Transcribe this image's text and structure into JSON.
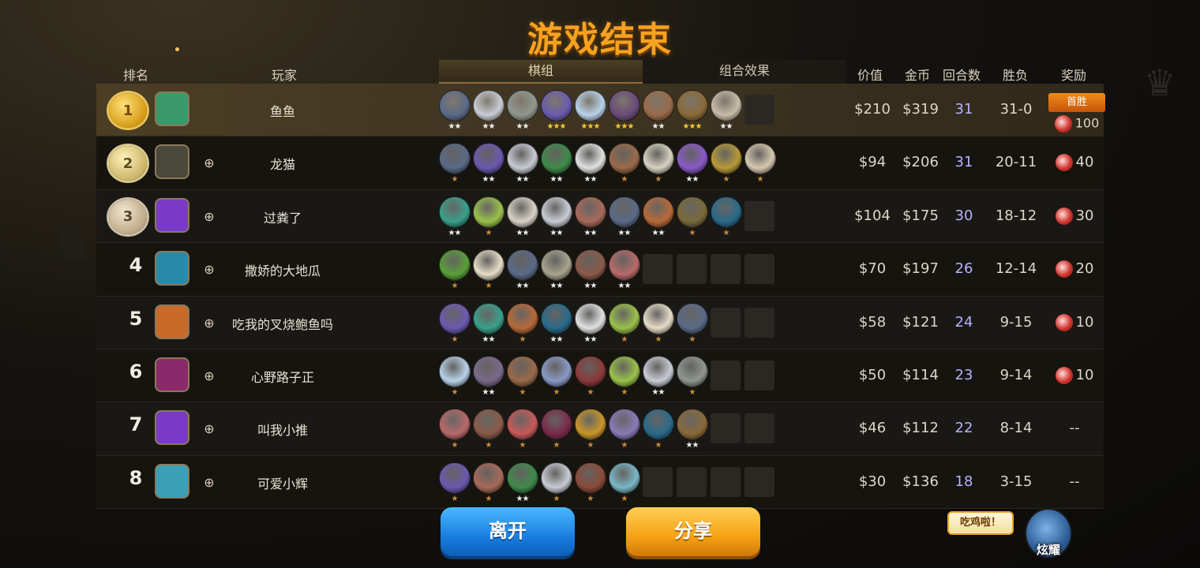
{
  "title": "游戏结束",
  "headers": {
    "rank": "排名",
    "player": "玩家",
    "team": "棋组",
    "combo": "组合效果",
    "value": "价值",
    "gold": "金币",
    "rounds": "回合数",
    "wl": "胜负",
    "reward": "奖励"
  },
  "rows": [
    {
      "rank": "1",
      "medal": "gold",
      "name": "鱼鱼",
      "value": "$210",
      "gold": "$319",
      "rounds": "31",
      "wl": "31-0",
      "reward": "100",
      "first_win": "首胜",
      "units": [
        {
          "c": "#5a6a88",
          "s": "★★"
        },
        {
          "c": "#c9ccd6",
          "s": "★★"
        },
        {
          "c": "#8f9890",
          "s": "★★"
        },
        {
          "c": "#6a5ab0",
          "s": "★★★",
          "t": "gold"
        },
        {
          "c": "#b8d2ea",
          "s": "★★★",
          "t": "gold"
        },
        {
          "c": "#6a4a7a",
          "s": "★★★",
          "t": "gold"
        },
        {
          "c": "#9a6a4a",
          "s": "★★"
        },
        {
          "c": "#8a6a3a",
          "s": "★★★",
          "t": "gold"
        },
        {
          "c": "#c8bca8",
          "s": "★★"
        },
        {
          "c": "",
          "s": ""
        }
      ]
    },
    {
      "rank": "2",
      "medal": "silver",
      "name": "龙猫",
      "value": "$94",
      "gold": "$206",
      "rounds": "31",
      "wl": "20-11",
      "reward": "40",
      "units": [
        {
          "c": "#5a6a88",
          "s": "★",
          "t": "bronze"
        },
        {
          "c": "#6a5ab0",
          "s": "★★"
        },
        {
          "c": "#c9ccd6",
          "s": "★★"
        },
        {
          "c": "#3f8a4a",
          "s": "★★"
        },
        {
          "c": "#e2e2e2",
          "s": "★★"
        },
        {
          "c": "#9a6a4a",
          "s": "★",
          "t": "bronze"
        },
        {
          "c": "#d8d2c0",
          "s": "★",
          "t": "bronze"
        },
        {
          "c": "#8a5ac8",
          "s": "★★"
        },
        {
          "c": "#b89a3a",
          "s": "★",
          "t": "bronze"
        },
        {
          "c": "#d8c8b0",
          "s": "★",
          "t": "bronze"
        }
      ]
    },
    {
      "rank": "3",
      "medal": "bronze",
      "name": "过粪了",
      "value": "$104",
      "gold": "$175",
      "rounds": "30",
      "wl": "18-12",
      "reward": "30",
      "units": [
        {
          "c": "#3aa08a",
          "s": "★★"
        },
        {
          "c": "#9ac24a",
          "s": "★",
          "t": "bronze"
        },
        {
          "c": "#d8d2c6",
          "s": "★★"
        },
        {
          "c": "#c9ccd6",
          "s": "★★"
        },
        {
          "c": "#a86a5a",
          "s": "★★"
        },
        {
          "c": "#5a6a88",
          "s": "★★"
        },
        {
          "c": "#b86a3a",
          "s": "★★"
        },
        {
          "c": "#7a6a3a",
          "s": "★",
          "t": "bronze"
        },
        {
          "c": "#2a6a8a",
          "s": "★",
          "t": "bronze"
        },
        {
          "c": "",
          "s": ""
        }
      ]
    },
    {
      "rank": "4",
      "medal": "",
      "name": "撒娇的大地瓜",
      "value": "$70",
      "gold": "$197",
      "rounds": "26",
      "wl": "12-14",
      "reward": "20",
      "units": [
        {
          "c": "#5aa03a",
          "s": "★",
          "t": "bronze"
        },
        {
          "c": "#e6ddc8",
          "s": "★",
          "t": "bronze"
        },
        {
          "c": "#5a6a88",
          "s": "★★"
        },
        {
          "c": "#a8a490",
          "s": "★★"
        },
        {
          "c": "#8a5a4a",
          "s": "★★"
        },
        {
          "c": "#b86a6a",
          "s": "★★"
        },
        {
          "c": "",
          "s": ""
        },
        {
          "c": "",
          "s": ""
        },
        {
          "c": "",
          "s": ""
        },
        {
          "c": "",
          "s": ""
        }
      ]
    },
    {
      "rank": "5",
      "medal": "",
      "name": "吃我的叉烧鲍鱼吗",
      "value": "$58",
      "gold": "$121",
      "rounds": "24",
      "wl": "9-15",
      "reward": "10",
      "units": [
        {
          "c": "#6a5ab0",
          "s": "★",
          "t": "bronze"
        },
        {
          "c": "#3aa08a",
          "s": "★★"
        },
        {
          "c": "#b86a3a",
          "s": "★",
          "t": "bronze"
        },
        {
          "c": "#2a6a8a",
          "s": "★★"
        },
        {
          "c": "#e2e2e2",
          "s": "★★"
        },
        {
          "c": "#9ac24a",
          "s": "★",
          "t": "bronze"
        },
        {
          "c": "#e6ddc8",
          "s": "★",
          "t": "bronze"
        },
        {
          "c": "#5a6a88",
          "s": "★",
          "t": "bronze"
        },
        {
          "c": "",
          "s": ""
        },
        {
          "c": "",
          "s": ""
        }
      ]
    },
    {
      "rank": "6",
      "medal": "",
      "name": "心野路子正",
      "value": "$50",
      "gold": "$114",
      "rounds": "23",
      "wl": "9-14",
      "reward": "10",
      "units": [
        {
          "c": "#b8d2ea",
          "s": "★",
          "t": "bronze"
        },
        {
          "c": "#7a6a8a",
          "s": "★★"
        },
        {
          "c": "#9a6a4a",
          "s": "★",
          "t": "bronze"
        },
        {
          "c": "#8a9ac8",
          "s": "★",
          "t": "bronze"
        },
        {
          "c": "#8a3a3a",
          "s": "★",
          "t": "bronze"
        },
        {
          "c": "#9ac24a",
          "s": "★",
          "t": "bronze"
        },
        {
          "c": "#c9ccd6",
          "s": "★★"
        },
        {
          "c": "#8f9890",
          "s": "★",
          "t": "bronze"
        },
        {
          "c": "",
          "s": ""
        },
        {
          "c": "",
          "s": ""
        }
      ]
    },
    {
      "rank": "7",
      "medal": "",
      "name": "叫我小推",
      "value": "$46",
      "gold": "$112",
      "rounds": "22",
      "wl": "8-14",
      "reward": "--",
      "units": [
        {
          "c": "#b86a6a",
          "s": "★",
          "t": "bronze"
        },
        {
          "c": "#8a5a4a",
          "s": "★",
          "t": "bronze"
        },
        {
          "c": "#c85a5a",
          "s": "★",
          "t": "bronze"
        },
        {
          "c": "#7a2a4a",
          "s": "★",
          "t": "bronze"
        },
        {
          "c": "#c8962a",
          "s": "★",
          "t": "bronze"
        },
        {
          "c": "#8a7ab8",
          "s": "★",
          "t": "bronze"
        },
        {
          "c": "#2a6a8a",
          "s": "★",
          "t": "bronze"
        },
        {
          "c": "#8a6a3a",
          "s": "★★"
        },
        {
          "c": "",
          "s": ""
        },
        {
          "c": "",
          "s": ""
        }
      ]
    },
    {
      "rank": "8",
      "medal": "",
      "name": "可爱小辉",
      "value": "$30",
      "gold": "$136",
      "rounds": "18",
      "wl": "3-15",
      "reward": "--",
      "units": [
        {
          "c": "#6a5ab0",
          "s": "★",
          "t": "bronze"
        },
        {
          "c": "#a86a5a",
          "s": "★",
          "t": "bronze"
        },
        {
          "c": "#3f8a4a",
          "s": "★★"
        },
        {
          "c": "#c9ccd6",
          "s": "★",
          "t": "bronze"
        },
        {
          "c": "#8a4a3a",
          "s": "★",
          "t": "bronze"
        },
        {
          "c": "#7ab8c8",
          "s": "★",
          "t": "bronze"
        },
        {
          "c": "",
          "s": ""
        },
        {
          "c": "",
          "s": ""
        },
        {
          "c": "",
          "s": ""
        },
        {
          "c": "",
          "s": ""
        }
      ]
    }
  ],
  "avatars": [
    "#3a9a6a",
    "#4a4a3a",
    "#7a3ac8",
    "#2a8aa8",
    "#c86a2a",
    "#8a2a6a",
    "#7a3ac8",
    "#3aa0b8"
  ],
  "buttons": {
    "leave": "离开",
    "share": "分享"
  },
  "bubble": "吃鸡啦！",
  "show_off": "炫耀"
}
